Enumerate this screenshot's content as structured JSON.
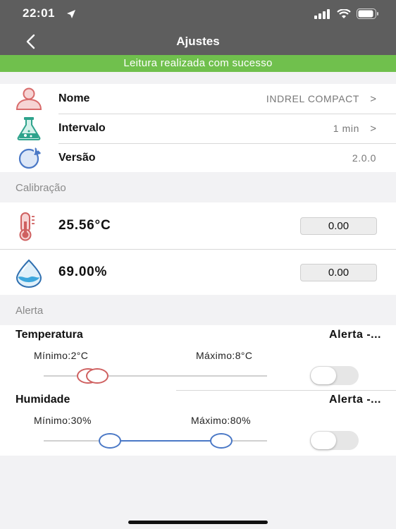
{
  "status_bar": {
    "time": "22:01"
  },
  "nav": {
    "title": "Ajustes"
  },
  "banner": {
    "message": "Leitura realizada com sucesso"
  },
  "settings": [
    {
      "label": "Nome",
      "value": "INDREL COMPACT",
      "chevron": ">",
      "icon": "user-icon"
    },
    {
      "label": "Intervalo",
      "value": "1 min",
      "chevron": ">",
      "icon": "flask-icon"
    },
    {
      "label": "Versão",
      "value": "2.0.0",
      "icon": "refresh-icon"
    }
  ],
  "calibration": {
    "header": "Calibração",
    "temperature": {
      "reading": "25.56°C",
      "offset": "0.00",
      "icon": "thermometer-icon"
    },
    "humidity": {
      "reading": "69.00%",
      "offset": "0.00",
      "icon": "water-drop-icon"
    }
  },
  "alerts": {
    "header": "Alerta",
    "temperature": {
      "title": "Temperatura",
      "status": "Alerta -...",
      "min_label": "Mínimo:2°C",
      "max_label": "Máximo:8°C",
      "enabled": false
    },
    "humidity": {
      "title": "Humidade",
      "status": "Alerta -...",
      "min_label": "Mínimo:30%",
      "max_label": "Máximo:80%",
      "enabled": false
    }
  },
  "colors": {
    "header_bg": "#5e5e5e",
    "banner_bg": "#70c04d",
    "slider_accent": "#4a78c6",
    "temperature_accent": "#cf6060"
  }
}
